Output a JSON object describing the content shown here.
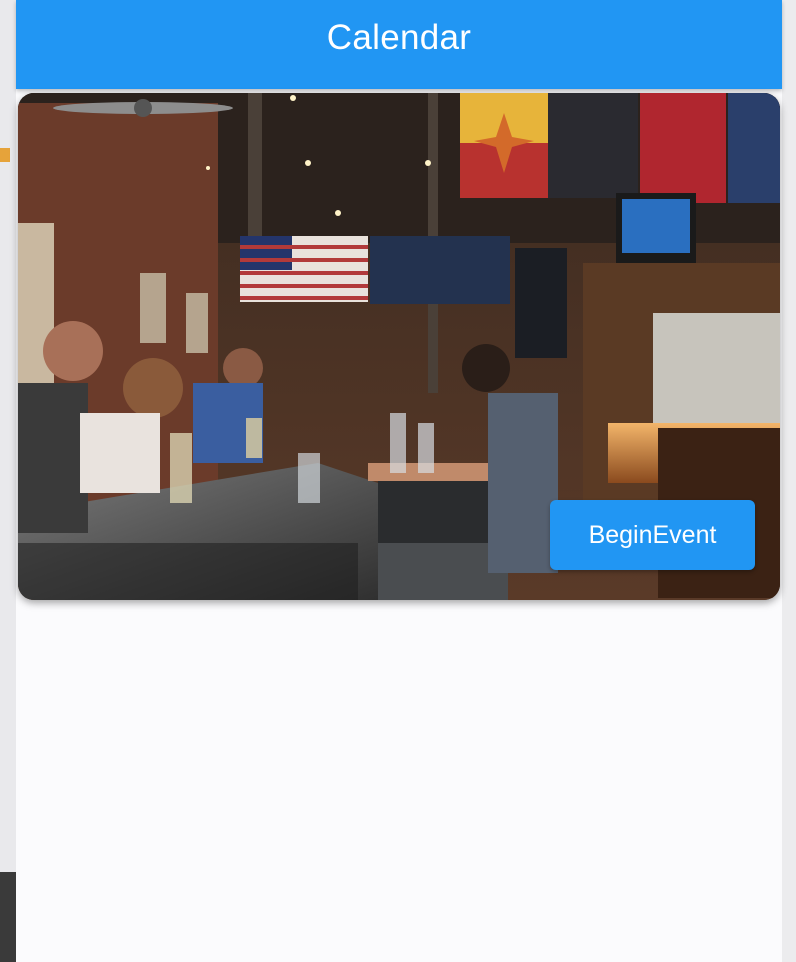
{
  "appbar": {
    "title": "Calendar"
  },
  "card": {
    "image_alt": "Bar interior with patrons and bartender",
    "action_button_label": "BeginEvent"
  },
  "colors": {
    "primary": "#2196f3",
    "background": "#fbfbfd"
  },
  "icons": [
    "ceiling-fan-icon"
  ]
}
